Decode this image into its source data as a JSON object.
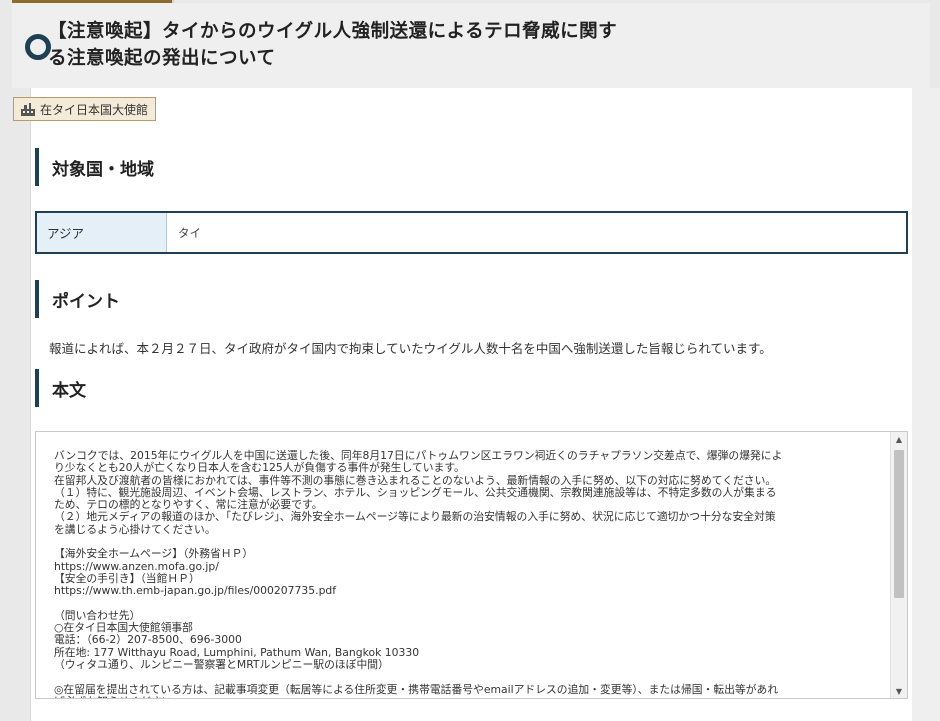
{
  "header": {
    "title_line1": "【注意喚起】タイからのウイグル人強制送還によるテロ脅威に関す",
    "title_line2": "る注意喚起の発出について"
  },
  "embassy_tag": {
    "label": "在タイ日本国大使館",
    "icon": "building-icon"
  },
  "sections": {
    "region": {
      "heading": "対象国・地域",
      "area": "アジア",
      "country": "タイ"
    },
    "point": {
      "heading": "ポイント",
      "text": "報道によれば、本２月２７日、タイ政府がタイ国内で拘束していたウイグル人数十名を中国へ強制送還した旨報じられています。"
    },
    "body": {
      "heading": "本文",
      "text": "バンコクでは、2015年にウイグル人を中国に送還した後、同年8月17日にパトゥムワン区エラワン祠近くのラチャプラソン交差点で、爆弾の爆発によ\nり少なくとも20人が亡くなり日本人を含む125人が負傷する事件が発生しています。\n在留邦人及び渡航者の皆様におかれては、事件等不測の事態に巻き込まれることのないよう、最新情報の入手に努め、以下の対応に努めてください。\n（１）特に、観光施設周辺、イベント会場、レストラン、ホテル、ショッピングモール、公共交通機関、宗教関連施設等は、不特定多数の人が集まる\nため、テロの標的となりやすく、常に注意が必要です。\n（２）地元メディアの報道のほか、「たびレジ」、海外安全ホームページ等により最新の治安情報の入手に努め、状況に応じて適切かつ十分な安全対策\nを講じるよう心掛けてください。\n\n【海外安全ホームページ】（外務省ＨＰ）\nhttps://www.anzen.mofa.go.jp/\n【安全の手引き】（当館ＨＰ）\nhttps://www.th.emb-japan.go.jp/files/000207735.pdf\n\n（問い合わせ先）\n○在タイ日本国大使館領事部\n電話：（66-2）207-8500、696-3000\n所在地: 177 Witthayu Road, Lumphini, Pathum Wan, Bangkok 10330\n（ウィタユ通り、ルンピニー警察署とMRTルンピニー駅のほぼ中間）\n\n◎在留届を提出されている方は、記載事項変更（転居等による住所変更・携帯電話番号やemailアドレスの追加・変更等）、または帰国・転出等があれ\nば必ずお知らせください。"
    }
  },
  "colors": {
    "accent": "#1f3f55",
    "tag_bg": "#f4ead8",
    "tag_border": "#b89b6b",
    "region_label_bg": "#e4eff7"
  }
}
